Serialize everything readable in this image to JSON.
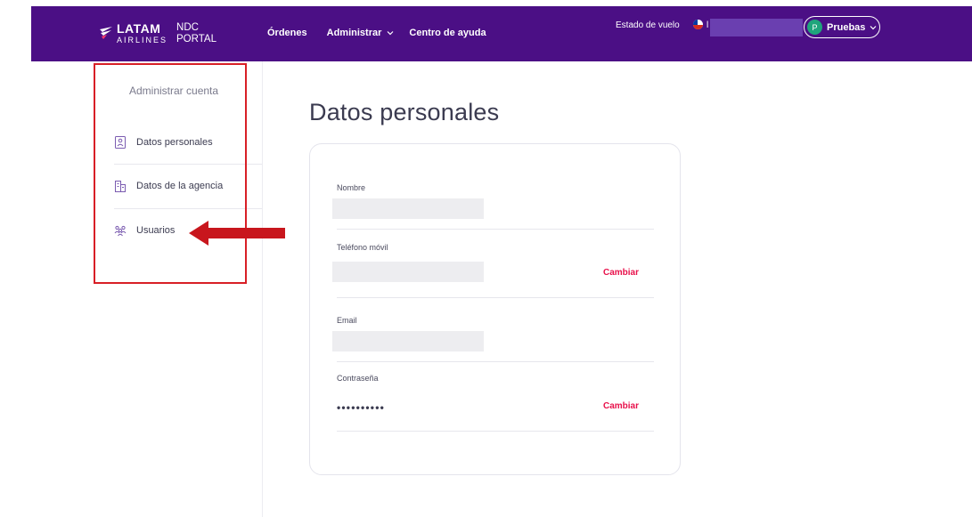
{
  "header": {
    "brand": {
      "name": "LATAM",
      "sub": "AIRLINES",
      "portal_line1": "NDC",
      "portal_line2": "PORTAL"
    },
    "nav": [
      {
        "label": "Órdenes",
        "has_dropdown": false
      },
      {
        "label": "Administrar",
        "has_dropdown": true
      },
      {
        "label": "Centro de ayuda",
        "has_dropdown": false
      }
    ],
    "flight_status_label": "Estado de vuelo",
    "user_initial_fragment": "l",
    "profile": {
      "avatar_letter": "P",
      "label": "Pruebas"
    }
  },
  "sidebar": {
    "title": "Administrar cuenta",
    "items": [
      {
        "label": "Datos personales",
        "icon": "id-badge-icon"
      },
      {
        "label": "Datos de la agencia",
        "icon": "building-icon"
      },
      {
        "label": "Usuarios",
        "icon": "users-icon"
      }
    ]
  },
  "main": {
    "title": "Datos personales",
    "fields": [
      {
        "label": "Nombre",
        "value": "",
        "action": ""
      },
      {
        "label": "Teléfono móvil",
        "value": "",
        "action": "Cambiar"
      },
      {
        "label": "Email",
        "value": "",
        "action": ""
      },
      {
        "label": "Contraseña",
        "value": "••••••••••",
        "action": "Cambiar"
      }
    ]
  },
  "colors": {
    "topbar": "#4b0f85",
    "accent": "#e8114b",
    "annotation": "#d81f26",
    "avatar": "#1fa57c"
  }
}
